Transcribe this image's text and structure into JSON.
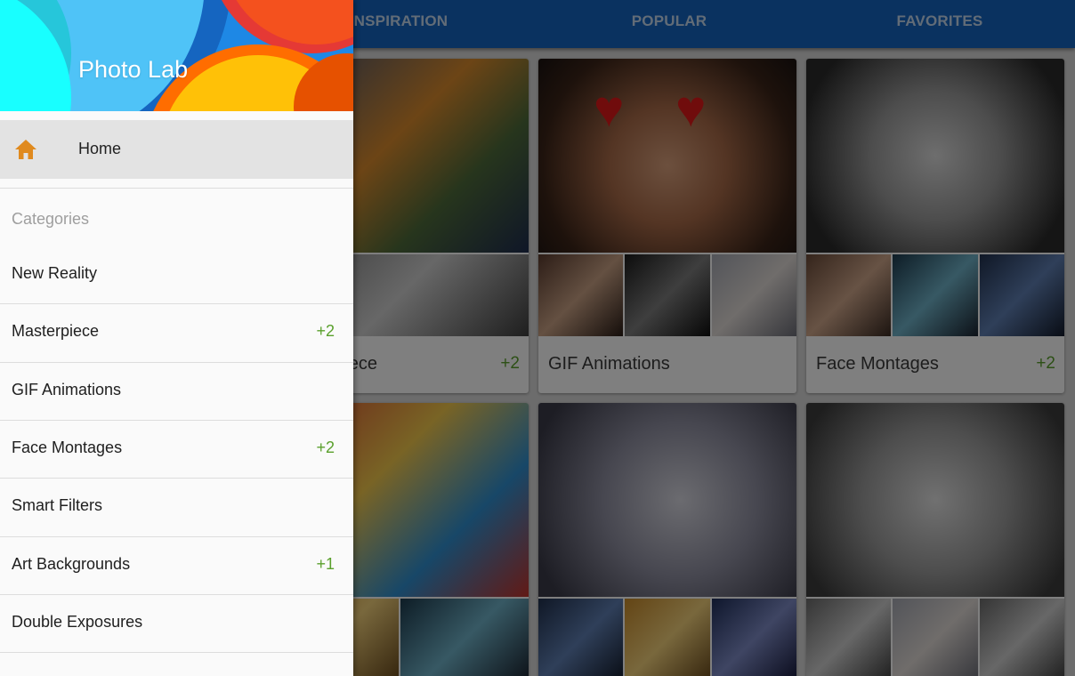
{
  "tabs": [
    {
      "label": "INSPIRATION"
    },
    {
      "label": "POPULAR"
    },
    {
      "label": "FAVORITES"
    }
  ],
  "cards": [
    {
      "label": "Masterpiece",
      "badge": "+2"
    },
    {
      "label": "GIF Animations",
      "badge": ""
    },
    {
      "label": "Face Montages",
      "badge": "+2"
    },
    {
      "label": "",
      "badge": ""
    },
    {
      "label": "",
      "badge": ""
    },
    {
      "label": "",
      "badge": ""
    }
  ],
  "drawer": {
    "app_title": "Photo Lab",
    "home_label": "Home",
    "home_icon": "home-icon",
    "categories_header": "Categories",
    "items": [
      {
        "label": "New Reality",
        "badge": ""
      },
      {
        "label": "Masterpiece",
        "badge": "+2"
      },
      {
        "label": "GIF Animations",
        "badge": ""
      },
      {
        "label": "Face Montages",
        "badge": "+2"
      },
      {
        "label": "Smart Filters",
        "badge": ""
      },
      {
        "label": "Art Backgrounds",
        "badge": "+1"
      },
      {
        "label": "Double Exposures",
        "badge": ""
      }
    ]
  },
  "colors": {
    "appbar": "#1565c0",
    "accent_badge": "#5aa02c",
    "home_icon": "#e08a1e"
  }
}
